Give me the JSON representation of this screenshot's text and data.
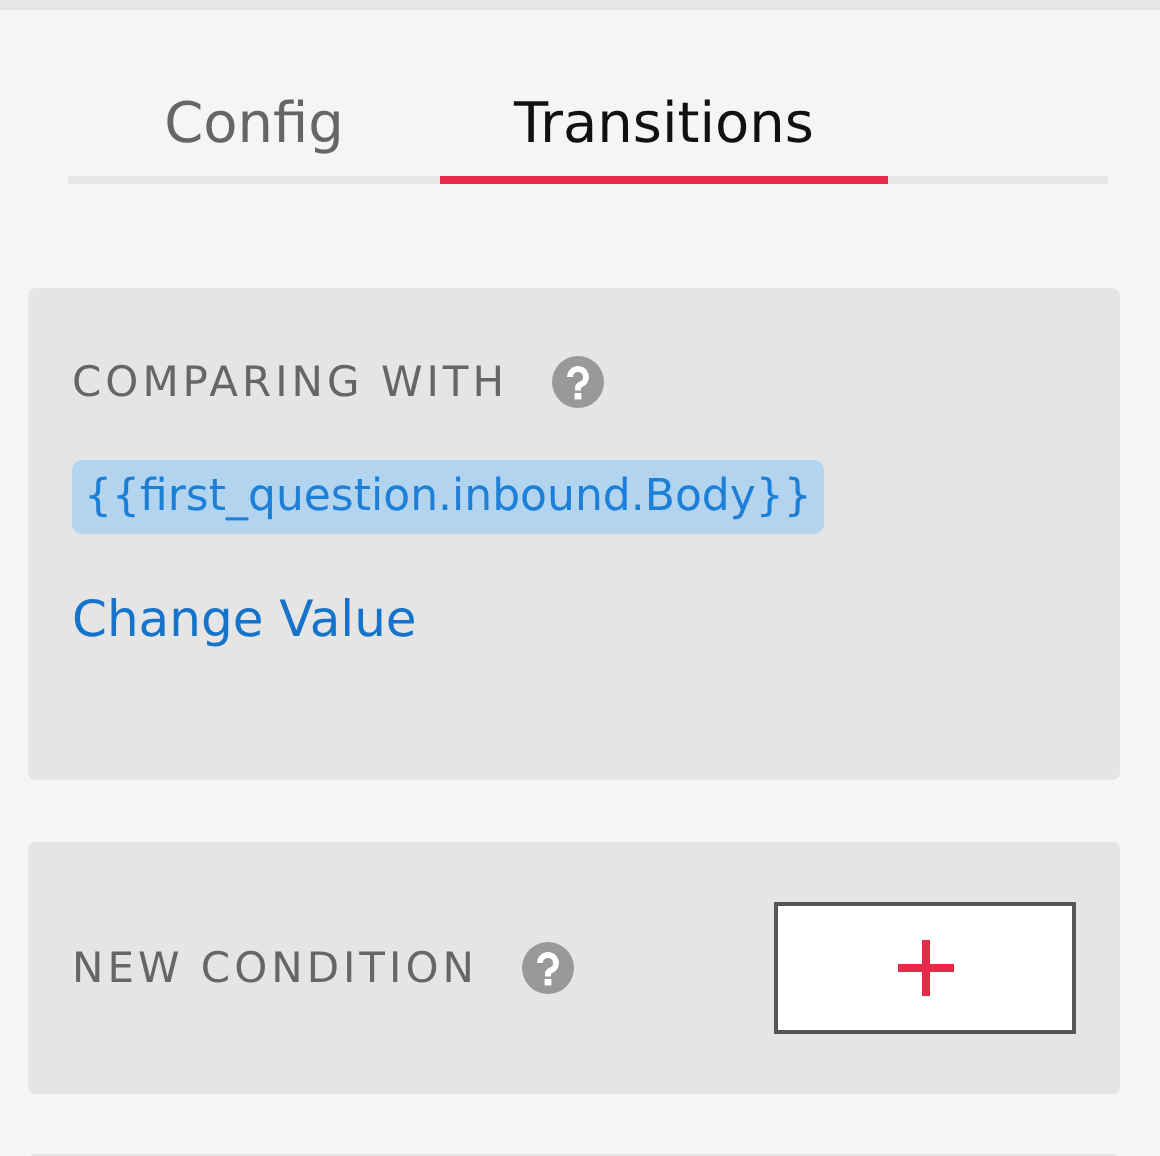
{
  "tabs": [
    {
      "label": "Config",
      "selected": false
    },
    {
      "label": "Transitions",
      "selected": true
    }
  ],
  "comparing_panel": {
    "title": "COMPARING WITH",
    "token": "{{first_question.inbound.Body}}",
    "link": "Change Value"
  },
  "condition_panel": {
    "title": "NEW CONDITION"
  }
}
